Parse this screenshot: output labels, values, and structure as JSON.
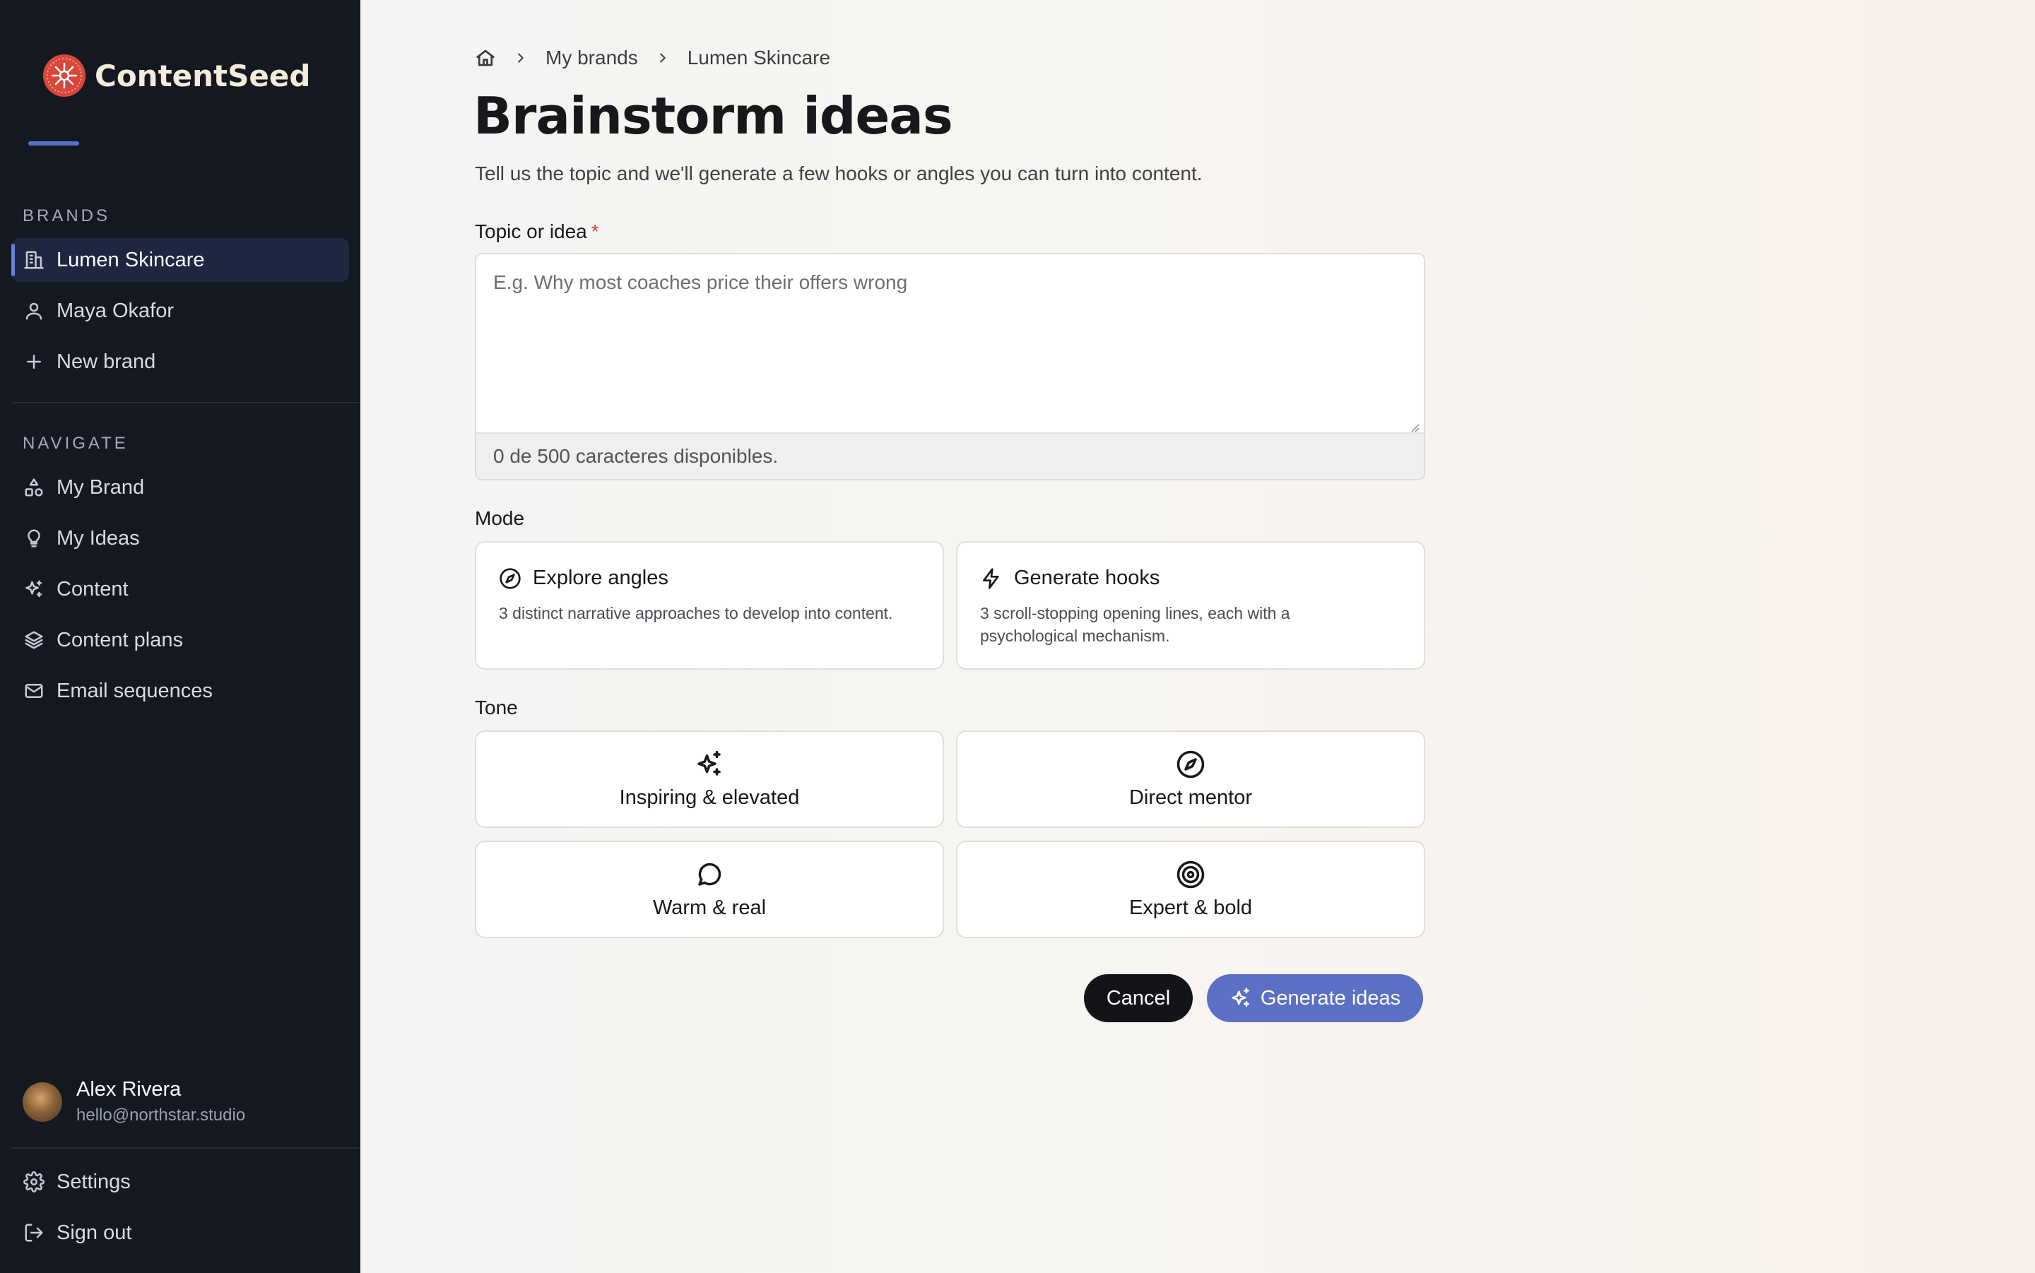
{
  "app": {
    "name": "ContentSeed"
  },
  "sidebar": {
    "brands_label": "BRANDS",
    "brands": [
      {
        "label": "Lumen Skincare",
        "icon": "building-icon",
        "active": true
      },
      {
        "label": "Maya Okafor",
        "icon": "user-icon",
        "active": false
      },
      {
        "label": "New brand",
        "icon": "plus-icon",
        "active": false
      }
    ],
    "navigate_label": "NAVIGATE",
    "nav": [
      {
        "label": "My Brand",
        "icon": "shapes-icon"
      },
      {
        "label": "My Ideas",
        "icon": "lightbulb-icon"
      },
      {
        "label": "Content",
        "icon": "sparkles-icon"
      },
      {
        "label": "Content plans",
        "icon": "layers-icon"
      },
      {
        "label": "Email sequences",
        "icon": "mail-icon"
      }
    ],
    "user": {
      "name": "Alex Rivera",
      "email": "hello@northstar.studio"
    },
    "settings_label": "Settings",
    "signout_label": "Sign out"
  },
  "breadcrumb": {
    "items": [
      "My brands",
      "Lumen Skincare"
    ]
  },
  "page": {
    "title": "Brainstorm ideas",
    "subtitle": "Tell us the topic and we'll generate a few hooks or angles you can turn into content."
  },
  "topic": {
    "label": "Topic or idea",
    "required_mark": "*",
    "placeholder": "E.g. Why most coaches price their offers wrong",
    "value": "",
    "char_count": "0 de 500 caracteres disponibles."
  },
  "mode": {
    "label": "Mode",
    "options": [
      {
        "title": "Explore angles",
        "desc": "3 distinct narrative approaches to develop into content.",
        "icon": "compass-icon"
      },
      {
        "title": "Generate hooks",
        "desc": "3 scroll-stopping opening lines, each with a psychological mechanism.",
        "icon": "lightning-icon"
      }
    ]
  },
  "tone": {
    "label": "Tone",
    "options": [
      {
        "label": "Inspiring & elevated",
        "icon": "sparkles-icon"
      },
      {
        "label": "Direct mentor",
        "icon": "compass-icon"
      },
      {
        "label": "Warm & real",
        "icon": "chat-bubble-icon"
      },
      {
        "label": "Expert & bold",
        "icon": "target-icon"
      }
    ]
  },
  "actions": {
    "cancel": "Cancel",
    "generate": "Generate ideas"
  },
  "colors": {
    "sidebar_bg": "#141821",
    "accent": "#5b6fc4",
    "brand_red": "#d9473b"
  }
}
